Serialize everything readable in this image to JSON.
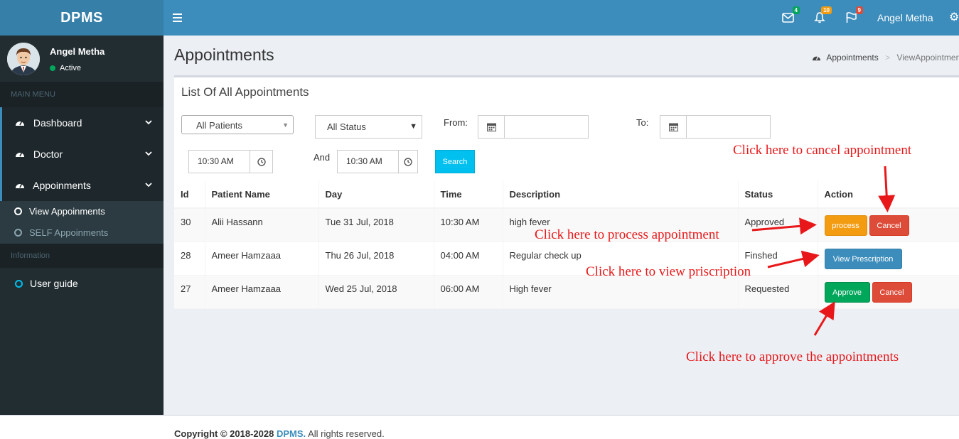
{
  "header": {
    "logo": "DPMS",
    "mail_badge": "4",
    "bell_badge": "10",
    "flag_badge": "9",
    "user_name": "Angel Metha"
  },
  "sidebar": {
    "user_name": "Angel Metha",
    "status": "Active",
    "main_menu_header": "MAIN MENU",
    "items": [
      {
        "label": "Dashboard"
      },
      {
        "label": "Doctor"
      },
      {
        "label": "Appoinments"
      }
    ],
    "subitems": [
      {
        "label": "View Appoinments"
      },
      {
        "label": "SELF Appoinments"
      }
    ],
    "info_header": "Information",
    "user_guide": "User guide"
  },
  "page": {
    "title": "Appointments",
    "breadcrumb_home": "Appointments",
    "breadcrumb_current": "ViewAppointments"
  },
  "box": {
    "title": "List Of All Appointments",
    "patient_select": "All Patients",
    "status_select": "All Status",
    "from_label": "From:",
    "to_label": "To:",
    "and_label": "And",
    "time_from": "10:30 AM",
    "time_to": "10:30 AM",
    "search_label": "Search"
  },
  "table": {
    "headers": [
      "Id",
      "Patient Name",
      "Day",
      "Time",
      "Description",
      "Status",
      "Action"
    ],
    "rows": [
      {
        "id": "30",
        "patient": "Alii Hassann",
        "day": "Tue 31 Jul, 2018",
        "time": "10:30 AM",
        "description": "high fever",
        "status": "Approved"
      },
      {
        "id": "28",
        "patient": "Ameer Hamzaaa",
        "day": "Thu 26 Jul, 2018",
        "time": "04:00 AM",
        "description": "Regular check up",
        "status": "Finshed"
      },
      {
        "id": "27",
        "patient": "Ameer Hamzaaa",
        "day": "Wed 25 Jul, 2018",
        "time": "06:00 AM",
        "description": "High fever",
        "status": "Requested"
      }
    ],
    "process_label": "process",
    "cancel_label": "Cancel",
    "view_prescription_label": "View Prescription",
    "approve_label": "Approve"
  },
  "annotations": {
    "cancel": "Click here to cancel appointment",
    "process": "Click here to process appointment",
    "prescription": "Click here to view priscription",
    "approve": "Click here to approve the appointments"
  },
  "footer": {
    "prefix": "Copyright © 2018-2028",
    "brand": "DPMS.",
    "suffix": "All rights reserved."
  },
  "colors": {
    "topbar": "#3c8dbc",
    "logo_bg": "#367fa9",
    "sidebar": "#222d32",
    "warning": "#f39c12",
    "danger": "#dd4b39",
    "primary": "#3c8dbc",
    "success": "#00a65a",
    "info": "#00c0ef",
    "annotation": "#e8181a"
  },
  "icons": [
    "menu-icon",
    "envelope-icon",
    "bell-icon",
    "flag-icon",
    "gears-icon",
    "dashboard-icon",
    "calendar-icon",
    "clock-icon",
    "chevron-down-icon",
    "circle-icon"
  ]
}
